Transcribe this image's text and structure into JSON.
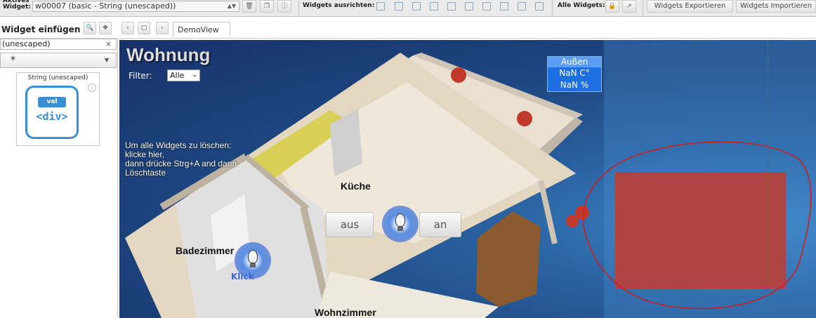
{
  "toolbar": {
    "active_widget_label": "Aktives\nWidget:",
    "active_widget_value": "w00007 (basic - String (unescaped))",
    "align_label": "Widgets ausrichten:",
    "all_widgets_label": "Alle Widgets:",
    "export_label": "Widgets Exportieren",
    "import_label": "Widgets Importieren"
  },
  "insert_panel": {
    "title": "Widget einfügen",
    "filter_value": "(unescaped)",
    "set_value": "*",
    "widget_name": "String (unescaped)",
    "icon_pill": "val",
    "icon_tag": "<div>",
    "info_glyph": "i"
  },
  "views": {
    "tabs": [
      {
        "label": "DemoView"
      }
    ]
  },
  "canvas": {
    "title": "Wohnung",
    "filter_label": "Filter:",
    "filter_value": "Alle",
    "hint": "Um alle Widgets zu löschen:\nklicke hier,\ndann drücke Strg+A and dann Löschtaste",
    "aussen": {
      "header": "Außen",
      "temperature": "NaN C°",
      "humidity": "NaN %"
    },
    "rooms": {
      "kueche": "Küche",
      "bad": "Badezimmer",
      "wohn": "Wohnzimmer"
    },
    "buttons": {
      "off": "aus",
      "on": "an"
    },
    "klick": "Klick"
  },
  "colors": {
    "accent": "#3a8fd4",
    "canvas_bg": "#1e4780",
    "red_block": "#b04343",
    "annotation": "#cc1f1f"
  }
}
